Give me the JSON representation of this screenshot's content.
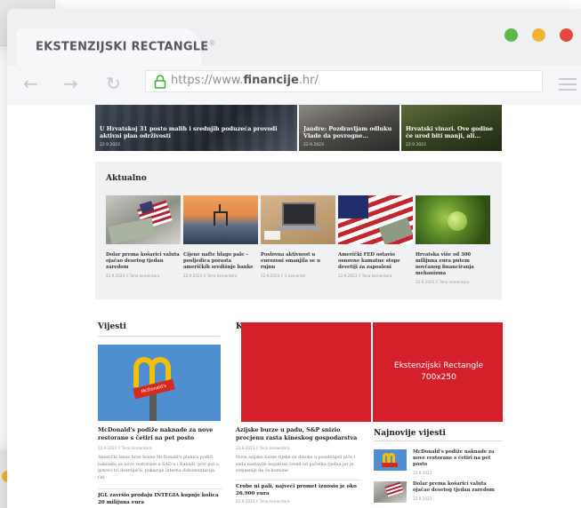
{
  "window": {
    "tab_title": "EKSTENZIJSKI RECTANGLE",
    "tab_mark": "®",
    "url_prefix": "https://www.",
    "url_domain": "financije",
    "url_suffix": ".hr/",
    "dots": [
      "#5bb94a",
      "#f2b233",
      "#e8473f"
    ]
  },
  "hero": [
    {
      "title": "U Hrvatskoj 31 posto malih i srednjih poduzeća provodi aktivni plan održivosti",
      "date": "22.9.2023"
    },
    {
      "title": "Jandre: Pozdravljam odluku Vlade da povrogne...",
      "date": "22.9.2023"
    },
    {
      "title": "Hrvatski vinari. Ove godine će urod biti manji, ali...",
      "date": "22.9.2023"
    }
  ],
  "aktualno": {
    "title": "Aktualno",
    "items": [
      {
        "text": "Dolar prema košarici valuta ojačao desetog tjedan zaredom",
        "meta": "22.9.2023 // Tena komentara"
      },
      {
        "text": "Cijene nafte blago pale – posljedica porasta američkih središnje banke",
        "meta": "22.9.2023 // Tena komentara"
      },
      {
        "text": "Poslovna aktivnost u eurozoni smanjila se u rujnu",
        "meta": "22.9.2023 // 1 komentar"
      },
      {
        "text": "Američki FED ostavio osnovne kamatne stope devetiji za zaposleni",
        "meta": "22.9.2023 // Tena komentara"
      },
      {
        "text": "Hrvatska više od 300 milijuna eura putem novčanog financiranja mehanizma",
        "meta": "22.9.2023 // Tena komentara"
      }
    ]
  },
  "vijesti": {
    "title": "Vijesti",
    "other_head": "K",
    "articles": [
      {
        "title": "McDonald's podiže naknade za nove restorane s četiri na pet posto",
        "meta": "22.9.2023 // Tena komentara",
        "body": "Američki lanac brze hrane McDonald's planira podići naknadu za nove restorane u SAD-u i Kanadi, prvi put u gotovo tri desetljeća, pokazuje interna dokumentacija. Od"
      },
      {
        "title": "JGL završio prodaju INTEGIA kupnje kolica 20 milijuna eura",
        "meta": ""
      },
      {
        "title": "Azijske burze u padu, S&P snizio procjenu rasta kineskog gospodarstva",
        "meta": "22.9.2023 // Tena komentara",
        "body": "Nove azijske burze rijeke su dinoke u posebitijeli piće i sada nastavile negativni trend od početka tjedna jer je svejasnije da će komone"
      },
      {
        "title": "Crobe ni pali, najveći promet izuosio je oko 26.900 eura",
        "meta": "22.9.2023 // Tena komentara"
      }
    ]
  },
  "ad": {
    "line1": "Ekstenzijski Rectangle",
    "line2": "700x250"
  },
  "najnovije": {
    "title": "Najnovije vijesti",
    "items": [
      {
        "text": "McDonald's podiže naknade za nove restorane s četiri na pet posto",
        "date": "22.9.2023"
      },
      {
        "text": "Dolar prema košarici valuta ojačao desetog tjedan zaredom",
        "date": "22.9.2023"
      }
    ]
  }
}
